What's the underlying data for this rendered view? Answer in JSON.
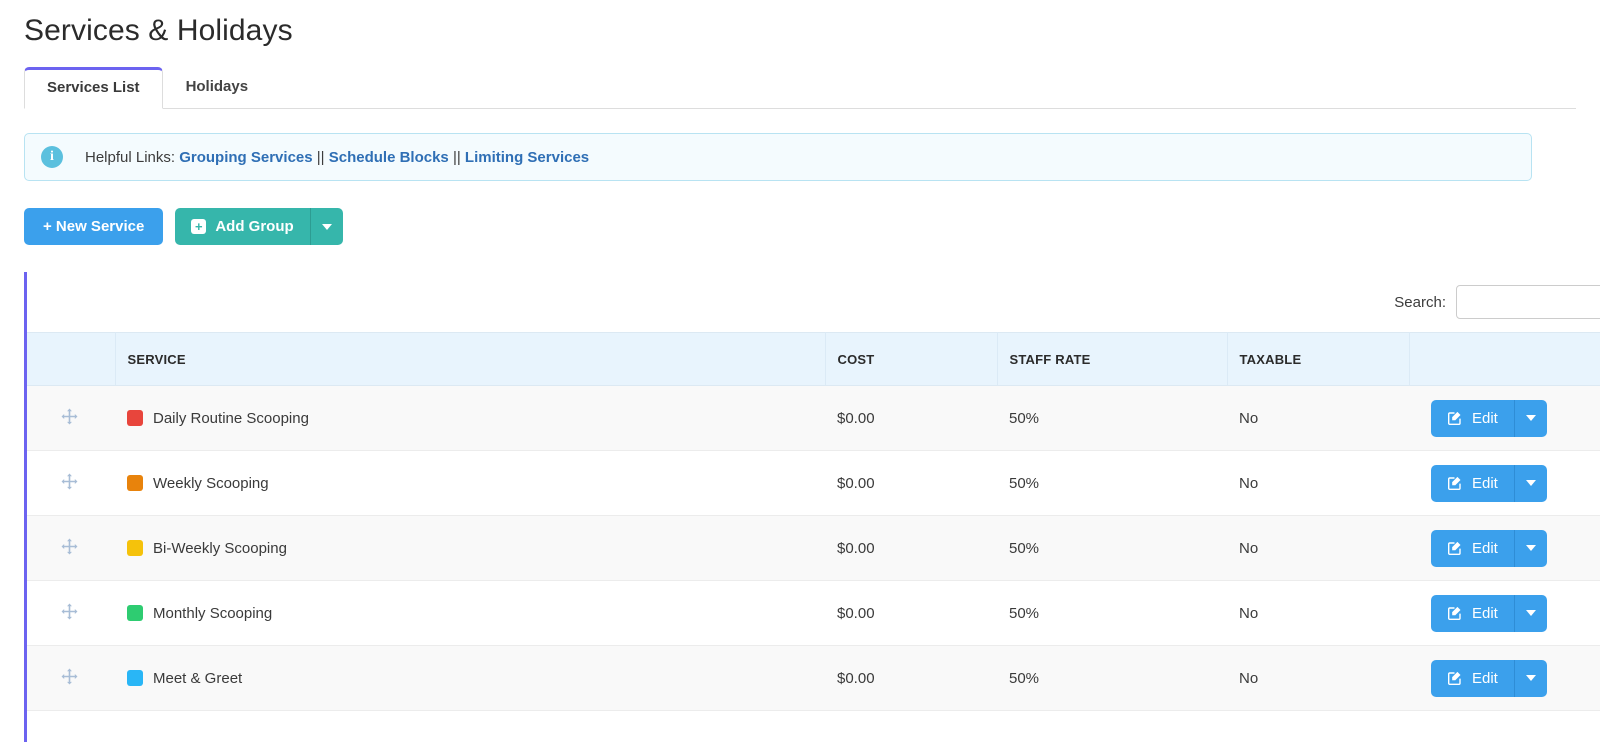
{
  "page": {
    "title": "Services & Holidays"
  },
  "tabs": [
    {
      "label": "Services List",
      "active": true
    },
    {
      "label": "Holidays",
      "active": false
    }
  ],
  "info_banner": {
    "icon": "info-circle-icon",
    "prefix": "Helpful Links:",
    "separator": "||",
    "links": [
      "Grouping Services",
      "Schedule Blocks",
      "Limiting Services"
    ]
  },
  "toolbar": {
    "new_service_label": "+ New Service",
    "add_group_label": "Add Group",
    "add_group_icon": "plus-square-icon",
    "add_group_caret_icon": "caret-down-icon"
  },
  "search": {
    "label": "Search:",
    "value": "",
    "placeholder": ""
  },
  "table": {
    "columns": [
      "",
      "SERVICE",
      "COST",
      "STAFF RATE",
      "TAXABLE",
      ""
    ],
    "row_action": {
      "edit_label": "Edit",
      "edit_icon": "pencil-square-icon",
      "caret_icon": "caret-down-icon"
    },
    "rows": [
      {
        "handle_icon": "drag-move-icon",
        "color": "#e8453c",
        "service": "Daily Routine Scooping",
        "cost": "$0.00",
        "staff_rate": "50%",
        "taxable": "No"
      },
      {
        "handle_icon": "drag-move-icon",
        "color": "#e8830c",
        "service": "Weekly Scooping",
        "cost": "$0.00",
        "staff_rate": "50%",
        "taxable": "No"
      },
      {
        "handle_icon": "drag-move-icon",
        "color": "#f5c20b",
        "service": "Bi-Weekly Scooping",
        "cost": "$0.00",
        "staff_rate": "50%",
        "taxable": "No"
      },
      {
        "handle_icon": "drag-move-icon",
        "color": "#2ecc71",
        "service": "Monthly Scooping",
        "cost": "$0.00",
        "staff_rate": "50%",
        "taxable": "No"
      },
      {
        "handle_icon": "drag-move-icon",
        "color": "#29b6f6",
        "service": "Meet & Greet",
        "cost": "$0.00",
        "staff_rate": "50%",
        "taxable": "No"
      }
    ]
  },
  "colors": {
    "accent_purple": "#6c63f0",
    "primary_blue": "#3ba0ec",
    "teal": "#36b6ab",
    "header_blue": "#e8f4fd",
    "link_blue": "#2f6fb5"
  }
}
